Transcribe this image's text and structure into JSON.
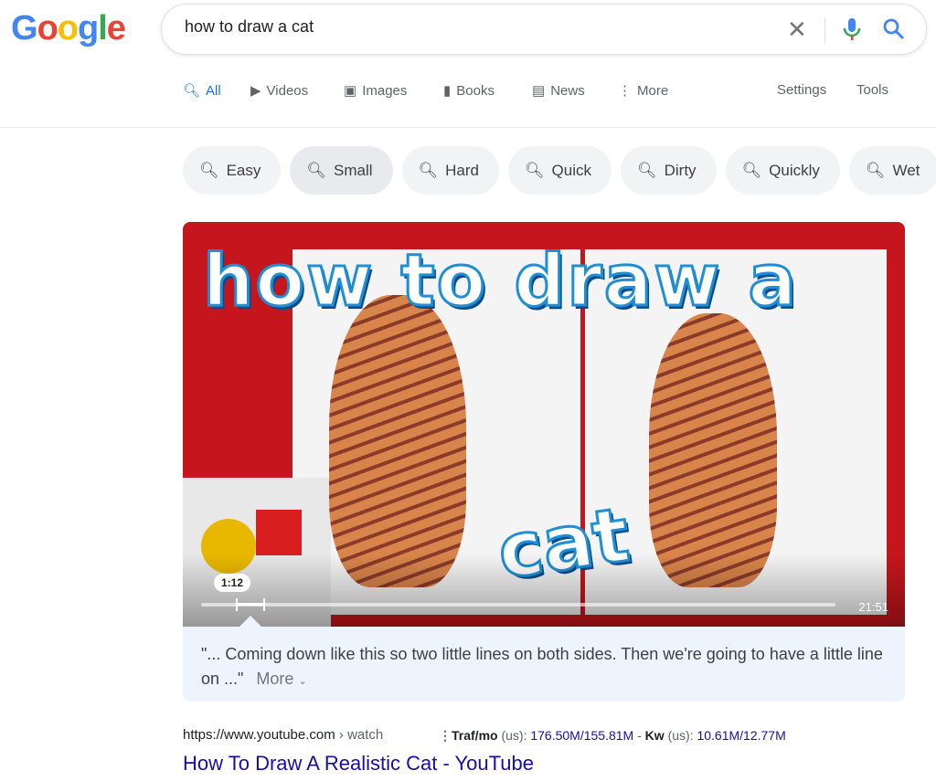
{
  "logo": "Google",
  "search": {
    "query": "how to draw a cat"
  },
  "tabs": [
    {
      "label": "All",
      "icon": "search-icon"
    },
    {
      "label": "Videos",
      "icon": "play-icon"
    },
    {
      "label": "Images",
      "icon": "image-icon"
    },
    {
      "label": "Books",
      "icon": "book-icon"
    },
    {
      "label": "News",
      "icon": "news-icon"
    },
    {
      "label": "More",
      "icon": "kebab-icon"
    }
  ],
  "settings": "Settings",
  "tools": "Tools",
  "chips": [
    "Easy",
    "Small",
    "Hard",
    "Quick",
    "Dirty",
    "Quickly",
    "Wet"
  ],
  "video": {
    "thumb_text_1": "how to draw a",
    "thumb_text_2": "cat",
    "timestamp": "1:12",
    "duration": "21:51",
    "progress_fraction": 0.055
  },
  "caption": {
    "text": "\"... Coming down like this so two little lines on both sides. Then we're going to have a little line on ...\"",
    "more": "More"
  },
  "result": {
    "url": "https://www.youtube.com",
    "path": "watch",
    "seo_traf_label": "Traf/mo",
    "seo_traf_region": "(us):",
    "seo_traf_value": "176.50M/155.81M",
    "seo_kw_label": "Kw",
    "seo_kw_region": "(us):",
    "seo_kw_value": "10.61M/12.77M",
    "title": "How To Draw A Realistic Cat - YouTube"
  }
}
